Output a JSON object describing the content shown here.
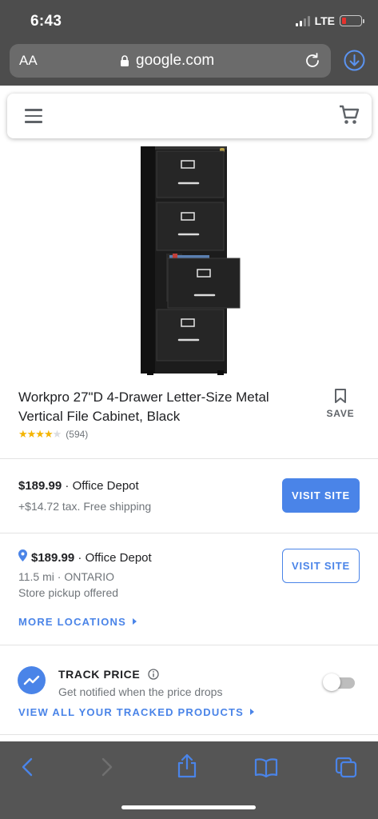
{
  "status_bar": {
    "time": "6:43",
    "network": "LTE"
  },
  "browser": {
    "text_size_label": "AA",
    "url": "google.com"
  },
  "product": {
    "title": "Workpro 27\"D 4-Drawer Letter-Size Metal Vertical File Cabinet, Black",
    "save_label": "SAVE",
    "rating": 4,
    "review_count": "(594)"
  },
  "offers": [
    {
      "price": "$189.99",
      "seller": "· Office Depot",
      "details": "+$14.72 tax. Free shipping",
      "button": "VISIT SITE"
    },
    {
      "price": "$189.99",
      "seller": "· Office Depot",
      "distance": "11.5 mi · ONTARIO",
      "pickup": "Store pickup offered",
      "button": "VISIT SITE"
    }
  ],
  "more_locations": "MORE LOCATIONS",
  "track_price": {
    "title": "TRACK PRICE",
    "subtitle": "Get notified when the price drops",
    "enabled": false,
    "view_all": "VIEW ALL YOUR TRACKED PRODUCTS"
  },
  "colors": {
    "accent": "#4a84e8",
    "star": "#f4b400",
    "battery_low": "#e5322d"
  }
}
